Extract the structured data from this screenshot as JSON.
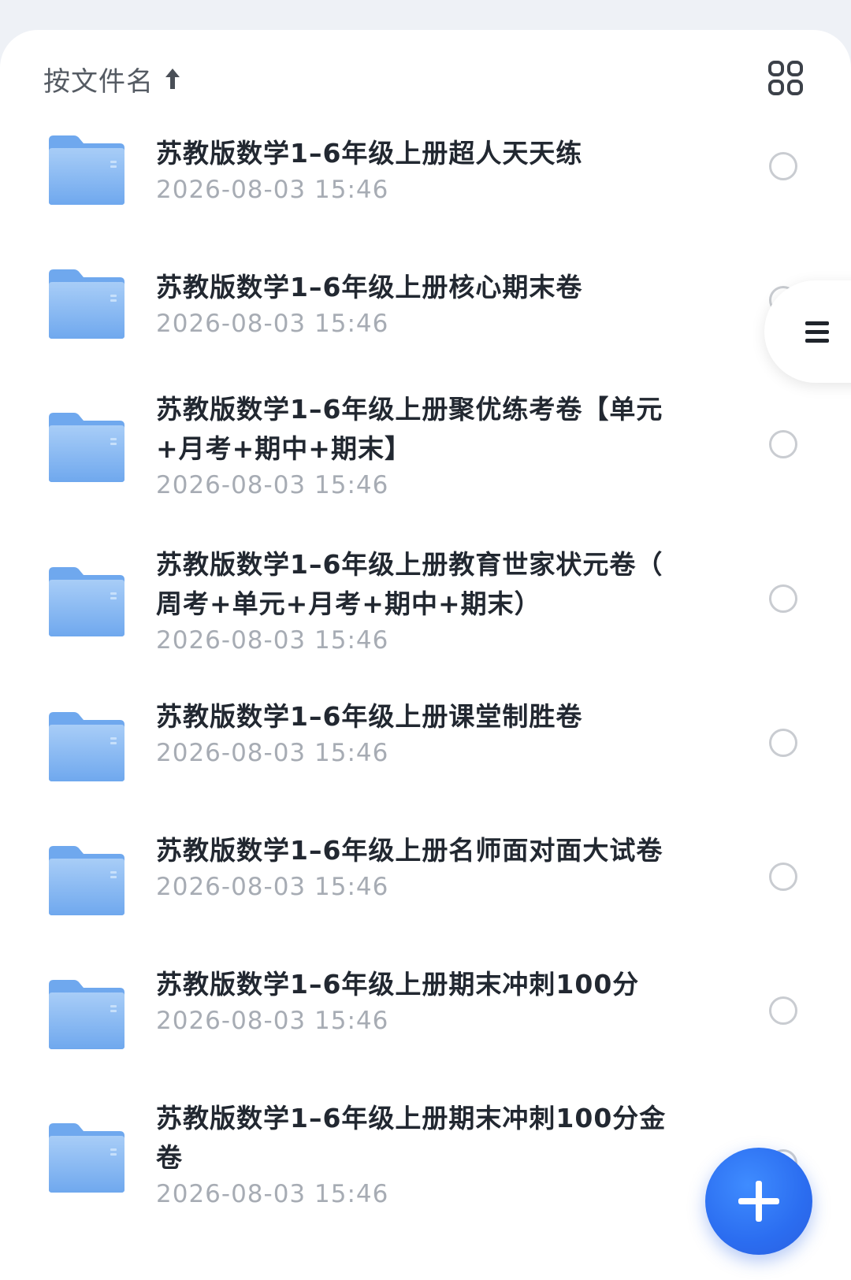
{
  "sort": {
    "label": "按文件名",
    "direction_icon": "arrow-up-icon"
  },
  "toolbar": {
    "view_toggle_icon": "grid-view-icon"
  },
  "side_handle": {
    "icon": "menu-icon"
  },
  "fab": {
    "icon": "plus-icon"
  },
  "colors": {
    "accent": "#2b6df0",
    "folder_light": "#a8cdf7",
    "folder_dark": "#6fa8ee",
    "title_text": "#222831",
    "date_text": "#a7acb4"
  },
  "files": [
    {
      "title_lines": [
        "苏教版数学1–6年级上册超人天天练"
      ],
      "date": "2026-08-03 15:46"
    },
    {
      "title_lines": [
        "苏教版数学1–6年级上册核心期末卷"
      ],
      "date": "2026-08-03 15:46"
    },
    {
      "title_lines": [
        "苏教版数学1–6年级上册聚优练考卷【单元",
        "+月考+期中+期末】"
      ],
      "date": "2026-08-03 15:46"
    },
    {
      "title_lines": [
        "苏教版数学1–6年级上册教育世家状元卷（",
        "周考+单元+月考+期中+期末）"
      ],
      "date": "2026-08-03 15:46"
    },
    {
      "title_lines": [
        "苏教版数学1–6年级上册课堂制胜卷"
      ],
      "date": "2026-08-03 15:46"
    },
    {
      "title_lines": [
        "苏教版数学1–6年级上册名师面对面大试卷"
      ],
      "date": "2026-08-03 15:46"
    },
    {
      "title_lines": [
        "苏教版数学1–6年级上册期末冲刺100分"
      ],
      "date": "2026-08-03 15:46"
    },
    {
      "title_lines": [
        "苏教版数学1–6年级上册期末冲刺100分金",
        "卷"
      ],
      "date": "2026-08-03 15:46"
    }
  ]
}
